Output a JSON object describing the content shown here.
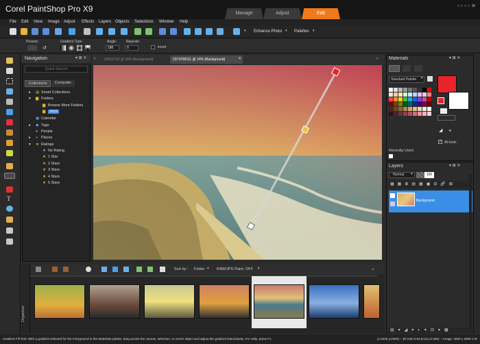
{
  "app": {
    "title": "Corel PaintShop Pro X9"
  },
  "workspace_tabs": [
    "Manage",
    "Adjust",
    "Edit"
  ],
  "menu": [
    "File",
    "Edit",
    "View",
    "Image",
    "Adjust",
    "Effects",
    "Layers",
    "Objects",
    "Selections",
    "Window",
    "Help"
  ],
  "toolbar": {
    "enhance_photo": "Enhance Photo",
    "palettes": "Palettes"
  },
  "options": {
    "presets_label": "Presets:",
    "gradient_type_label": "Gradient Type:",
    "angle_label": "Angle:",
    "angle_value": "180",
    "repeats_label": "Repeats:",
    "repeats_value": "0",
    "invert_label": "Invert"
  },
  "navigation": {
    "title": "Navigation",
    "quick_search_placeholder": "Quick Search",
    "tabs": [
      "Collections",
      "Computer"
    ],
    "tree": {
      "smart_collections": "Smart Collections",
      "folders": "Folders",
      "browse_more": "Browse More Folders",
      "folder_2016": "2016",
      "calendar": "Calendar",
      "tags": "Tags",
      "people": "People",
      "places": "Places",
      "ratings": "Ratings",
      "no_rating": "No Rating",
      "star1": "1 Star",
      "star2": "2 Stars",
      "star3": "3 Stars",
      "star4": "4 Stars",
      "star5": "5 Stars"
    }
  },
  "documents": {
    "tab1": "20516718 @  16% (Background)",
    "tab2": "2374799111 @  14% (Background)"
  },
  "organizer": {
    "side_label": "Organizer",
    "sort_by_label": "Sort by :",
    "sort_value": "Folder",
    "raw_pairs": "RAW/JPG Pairs: OFF"
  },
  "materials": {
    "title": "Materials",
    "palette_select": "Standard Palette",
    "all_tools": "All tools",
    "recently_used": "Recently Used"
  },
  "layers": {
    "title": "Layers",
    "blend_mode": "Normal",
    "opacity": "100",
    "background_layer": "Background"
  },
  "status": {
    "message": "Gradient Fill Tool: With a gradient selected for the Foreground in the Materials palette, drag across the canvas, selection, or vector object and adjust the gradient interactively. For Help, press F1",
    "info": "(x:2345 y:2060) -- (R:139,G:94,B:111,O:255) -- Image: 4000 x 3000 x RGB - 8 bits/channel"
  },
  "colors": {
    "accent_orange": "#f07a1a",
    "selection_blue": "#3b8ee6",
    "foreground_red": "#e8242a",
    "background_white": "#ffffff"
  }
}
